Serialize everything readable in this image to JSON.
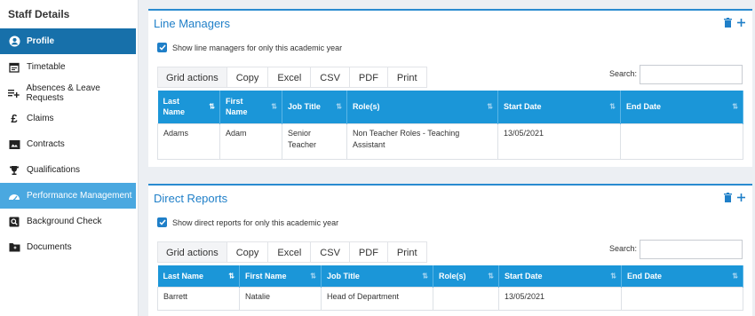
{
  "sidebar": {
    "title": "Staff Details",
    "items": [
      {
        "label": "Profile"
      },
      {
        "label": "Timetable"
      },
      {
        "label": "Absences & Leave Requests"
      },
      {
        "label": "Claims"
      },
      {
        "label": "Contracts"
      },
      {
        "label": "Qualifications"
      },
      {
        "label": "Performance Management"
      },
      {
        "label": "Background Check"
      },
      {
        "label": "Documents"
      }
    ]
  },
  "toolbar": {
    "grid_actions": "Grid actions",
    "copy": "Copy",
    "excel": "Excel",
    "csv": "CSV",
    "pdf": "PDF",
    "print": "Print",
    "search_label": "Search:"
  },
  "line_managers": {
    "title": "Line Managers",
    "checkbox_label": "Show line managers for only this academic year",
    "headers": [
      "Last Name",
      "First Name",
      "Job Title",
      "Role(s)",
      "Start Date",
      "End Date"
    ],
    "rows": [
      {
        "last": "Adams",
        "first": "Adam",
        "job": "Senior Teacher",
        "roles": "Non Teacher Roles - Teaching Assistant",
        "start": "13/05/2021",
        "end": ""
      }
    ]
  },
  "direct_reports": {
    "title": "Direct Reports",
    "checkbox_label": "Show direct reports for only this academic year",
    "headers": [
      "Last Name",
      "First Name",
      "Job Title",
      "Role(s)",
      "Start Date",
      "End Date"
    ],
    "rows": [
      {
        "last": "Barrett",
        "first": "Natalie",
        "job": "Head of Department",
        "roles": "",
        "start": "13/05/2021",
        "end": ""
      }
    ]
  },
  "colors": {
    "active_nav": "#1770aa",
    "hover_nav": "#4aa8e0",
    "header": "#1b96d8",
    "accent": "#1f7fc8"
  }
}
